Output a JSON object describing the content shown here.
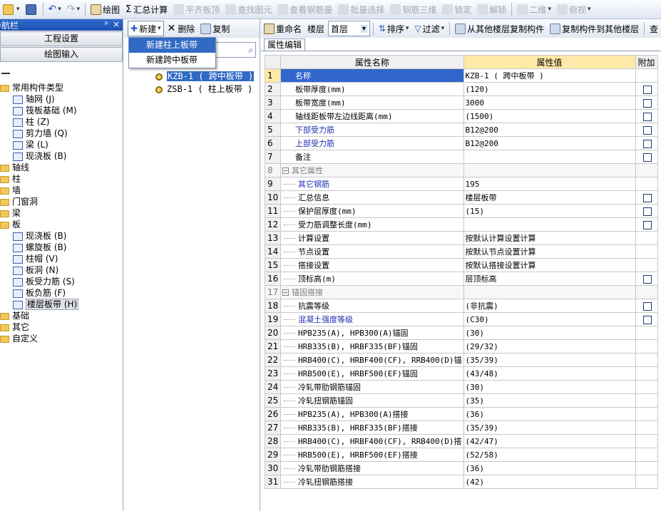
{
  "toolbar": {
    "items": [
      {
        "label": "绘图",
        "enabled": true
      },
      {
        "label": "汇总计算",
        "enabled": true
      },
      {
        "label": "平齐板顶",
        "enabled": false
      },
      {
        "label": "查找图元",
        "enabled": false
      },
      {
        "label": "查看钢筋量",
        "enabled": false
      },
      {
        "label": "批量选择",
        "enabled": false
      },
      {
        "label": "钢筋三维",
        "enabled": false
      },
      {
        "label": "锁定",
        "enabled": false
      },
      {
        "label": "解锁",
        "enabled": false
      },
      {
        "label": "二维",
        "enabled": false
      },
      {
        "label": "俯视",
        "enabled": false
      }
    ]
  },
  "nav": {
    "title": "导航栏",
    "pin": "ᵖ",
    "close": "×",
    "btn_settings": "工程设置",
    "btn_draw": "绘图输入",
    "root_title": "常用构件类型",
    "common": [
      "轴网 (J)",
      "筏板基础 (M)",
      "柱 (Z)",
      "剪力墙 (Q)",
      "梁 (L)",
      "现浇板 (B)"
    ],
    "folders1": [
      "轴线",
      "柱",
      "墙",
      "门窗洞",
      "梁",
      "板"
    ],
    "plate_children": [
      "现浇板 (B)",
      "螺旋板 (B)",
      "柱帽 (V)",
      "板洞 (N)",
      "板受力筋 (S)",
      "板负筋 (F)",
      "楼层板带 (H)"
    ],
    "folders2": [
      "基础",
      "其它",
      "自定义"
    ]
  },
  "mid": {
    "new_label": "新建",
    "delete_label": "删除",
    "copy_label": "复制",
    "components": [
      "KZB-1 ( 跨中板带 )",
      "ZSB-1 ( 柱上板带 )"
    ]
  },
  "popup": {
    "items": [
      "新建柱上板带",
      "新建跨中板带"
    ]
  },
  "right_toolbar": {
    "rename": "重命名",
    "floor_label": "楼层",
    "floor_value": "首层",
    "sort": "排序",
    "filter": "过滤",
    "copy_from": "从其他楼层复制构件",
    "copy_to": "复制构件到其他楼层",
    "more": "查"
  },
  "tab": "属性编辑",
  "grid": {
    "headers": [
      "属性名称",
      "属性值",
      "附加"
    ],
    "rows": [
      {
        "n": "1",
        "name": "名称",
        "value": "KZB-1 ( 跨中板带 )",
        "check": false,
        "style": "sel"
      },
      {
        "n": "2",
        "name": "板带厚度(mm)",
        "value": "(120)",
        "check": true
      },
      {
        "n": "3",
        "name": "板带宽度(mm)",
        "value": "3000",
        "check": true
      },
      {
        "n": "4",
        "name": "轴线距板带左边线距离(mm)",
        "value": "(1500)",
        "check": true
      },
      {
        "n": "5",
        "name": "下部受力筋",
        "value": "B12@200",
        "check": true,
        "style": "blue"
      },
      {
        "n": "6",
        "name": "上部受力筋",
        "value": "B12@200",
        "check": true,
        "style": "blue"
      },
      {
        "n": "7",
        "name": "备注",
        "value": "",
        "check": true
      },
      {
        "n": "8",
        "name": "其它属性",
        "value": "",
        "check": false,
        "style": "grp"
      },
      {
        "n": "9",
        "name": "其它钢筋",
        "value": "195",
        "check": false,
        "style": "blue-ind"
      },
      {
        "n": "10",
        "name": "汇总信息",
        "value": "楼层板带",
        "check": true,
        "style": "ind"
      },
      {
        "n": "11",
        "name": "保护层厚度(mm)",
        "value": "(15)",
        "check": true,
        "style": "ind"
      },
      {
        "n": "12",
        "name": "受力筋调整长度(mm)",
        "value": "",
        "check": true,
        "style": "ind"
      },
      {
        "n": "13",
        "name": "计算设置",
        "value": "按默认计算设置计算",
        "check": false,
        "style": "ind"
      },
      {
        "n": "14",
        "name": "节点设置",
        "value": "按默认节点设置计算",
        "check": false,
        "style": "ind"
      },
      {
        "n": "15",
        "name": "搭接设置",
        "value": "按默认搭接设置计算",
        "check": false,
        "style": "ind"
      },
      {
        "n": "16",
        "name": "顶标高(m)",
        "value": "层顶标高",
        "check": true,
        "style": "ind"
      },
      {
        "n": "17",
        "name": "锚固搭接",
        "value": "",
        "check": false,
        "style": "grp"
      },
      {
        "n": "18",
        "name": "抗震等级",
        "value": "(非抗震)",
        "check": true,
        "style": "ind"
      },
      {
        "n": "19",
        "name": "混凝土强度等级",
        "value": "(C30)",
        "check": true,
        "style": "blue-ind"
      },
      {
        "n": "20",
        "name": "HPB235(A), HPB300(A)锚固",
        "value": "(30)",
        "check": false,
        "style": "ind"
      },
      {
        "n": "21",
        "name": "HRB335(B), HRBF335(BF)锚固",
        "value": "(29/32)",
        "check": false,
        "style": "ind"
      },
      {
        "n": "22",
        "name": "HRB400(C), HRBF400(CF), RRB400(D)锚",
        "value": "(35/39)",
        "check": false,
        "style": "ind"
      },
      {
        "n": "23",
        "name": "HRB500(E), HRBF500(EF)锚固",
        "value": "(43/48)",
        "check": false,
        "style": "ind"
      },
      {
        "n": "24",
        "name": "冷轧带肋钢筋锚固",
        "value": "(30)",
        "check": false,
        "style": "ind"
      },
      {
        "n": "25",
        "name": "冷轧扭钢筋锚固",
        "value": "(35)",
        "check": false,
        "style": "ind"
      },
      {
        "n": "26",
        "name": "HPB235(A), HPB300(A)搭接",
        "value": "(36)",
        "check": false,
        "style": "ind"
      },
      {
        "n": "27",
        "name": "HRB335(B), HRBF335(BF)搭接",
        "value": "(35/39)",
        "check": false,
        "style": "ind"
      },
      {
        "n": "28",
        "name": "HRB400(C), HRBF400(CF), RRB400(D)搭",
        "value": "(42/47)",
        "check": false,
        "style": "ind"
      },
      {
        "n": "29",
        "name": "HRB500(E), HRBF500(EF)搭接",
        "value": "(52/58)",
        "check": false,
        "style": "ind"
      },
      {
        "n": "30",
        "name": "冷轧带肋钢筋搭接",
        "value": "(36)",
        "check": false,
        "style": "ind"
      },
      {
        "n": "31",
        "name": "冷轧扭钢筋搭接",
        "value": "(42)",
        "check": false,
        "style": "ind"
      }
    ]
  }
}
